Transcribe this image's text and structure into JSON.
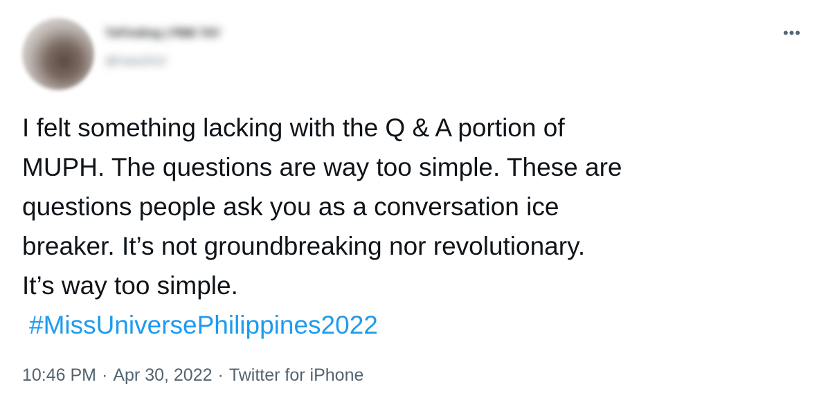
{
  "author": {
    "display_name": "ToFinding | PBB TAY",
    "handle": "@Cass2212"
  },
  "more_icon": "more-horizontal-icon",
  "tweet": {
    "text_lines": [
      "I felt something lacking with the Q & A portion of",
      "MUPH. The questions are way too simple. These are",
      "questions people ask you as a conversation ice",
      "breaker. It’s not groundbreaking nor revolutionary.",
      "It’s way too simple."
    ],
    "hashtag": "#MissUniversePhilippines2022"
  },
  "meta": {
    "time": "10:46 PM",
    "separator": "·",
    "date": "Apr 30, 2022",
    "source": "Twitter for iPhone"
  },
  "colors": {
    "text": "#0f1419",
    "secondary": "#536471",
    "link": "#1d9bf0",
    "background": "#ffffff"
  }
}
